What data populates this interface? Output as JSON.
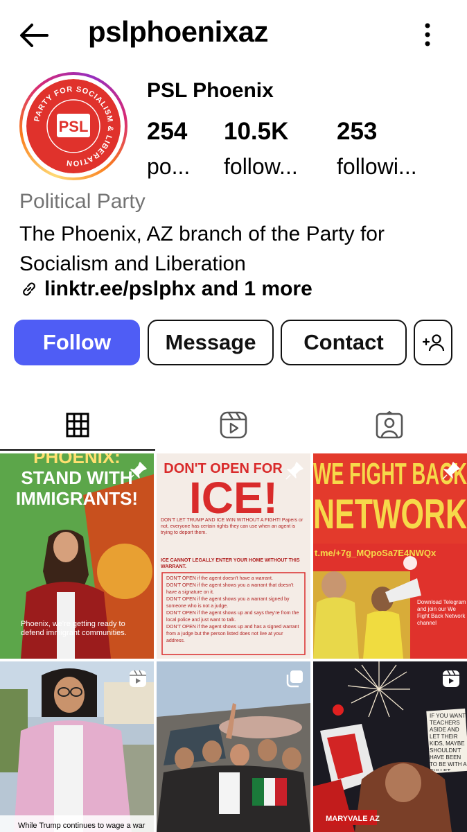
{
  "header": {
    "username": "pslphoenixaz"
  },
  "profile": {
    "display_name": "PSL Phoenix",
    "avatar_text": "PSL",
    "avatar_ring_text": "PARTY FOR SOCIALISM & LIBERATION",
    "stats": [
      {
        "value": "254",
        "label": "po..."
      },
      {
        "value": "10.5K",
        "label": "follow..."
      },
      {
        "value": "253",
        "label": "followi..."
      }
    ],
    "category": "Political Party",
    "bio": "The Phoenix, AZ branch of the Party for Socialism and Liberation",
    "link": "linktr.ee/pslphx and 1 more"
  },
  "actions": {
    "follow": "Follow",
    "message": "Message",
    "contact": "Contact"
  },
  "tabs": [
    "grid-icon",
    "reels-icon",
    "tagged-icon"
  ],
  "posts": [
    {
      "headline1": "PHOENIX:",
      "headline2": "STAND WITH",
      "headline3": "IMMIGRANTS!",
      "caption": "Phoenix, we're getting ready to defend immigrant communities.",
      "badge": "pin-icon"
    },
    {
      "headline1": "DON'T OPEN FOR",
      "headline2": "ICE!",
      "p1": "DON'T LET TRUMP AND ICE WIN WITHOUT A FIGHT! Papers or not, everyone has certain rights they can use when an agent is trying to deport them.",
      "p2": "ICE CANNOT LEGALLY ENTER YOUR HOME WITHOUT THIS WARRANT.",
      "rules": [
        "DON'T OPEN if the agent doesn't have a warrant.",
        "DON'T OPEN if the agent shows you a warrant that doesn't have a signature on it.",
        "DON'T OPEN if the agent shows you a warrant signed by someone who is not a judge.",
        "DON'T OPEN if the agent shows up and says they're from the local police and just want to talk.",
        "DON'T OPEN if the agent shows up and has a signed warrant from a judge but the person listed does not live at your address."
      ],
      "badge": "pin-icon"
    },
    {
      "headline1": "WE FIGHT BACK",
      "headline2": "NETWORK",
      "link": "t.me/+7g_MQpoSa7E4NWQx",
      "cta": "Download Telegram and join our We Fight Back Network channel",
      "badge": "pin-icon"
    },
    {
      "caption": "While Trump continues to wage a war",
      "badge": "reels-badge-icon"
    },
    {
      "badge": "carousel-icon"
    },
    {
      "caption": "MARYVALE AZ",
      "sign": "IF YOU WANT TEACHERS ASIDE AND LET THEIR KIDS, MAYBE SHOULDN'T HAVE BEEN TO BE WITH A BULLET",
      "badge": "reels-badge-icon"
    }
  ],
  "colors": {
    "follow_blue": "#4f5df5",
    "psl_red": "#e0322c",
    "grey_text": "#737373"
  }
}
